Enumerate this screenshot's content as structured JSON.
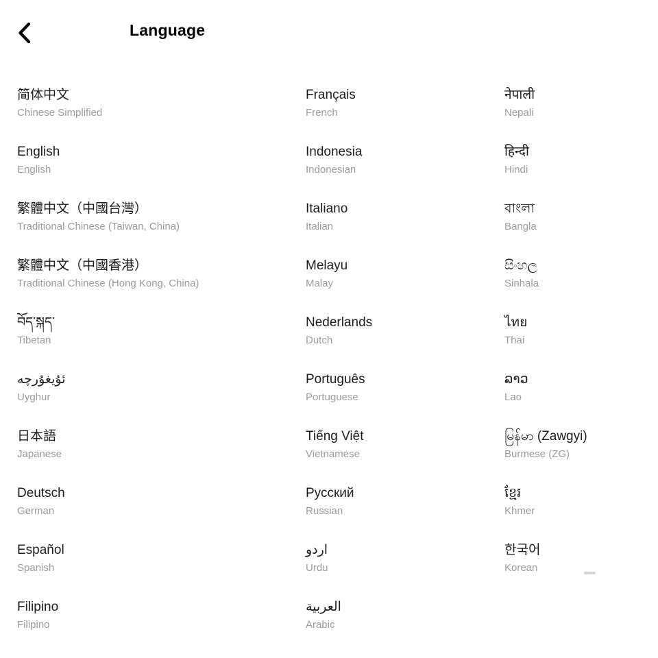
{
  "header": {
    "title": "Language",
    "back_icon": "chevron-left-icon"
  },
  "scroll_indicator": {
    "present": true,
    "color": "#d4d4d4"
  },
  "colors": {
    "background": "#ffffff",
    "primary_text": "#1c1c1c",
    "secondary_text": "#9b9b9b",
    "title_text": "#000000"
  },
  "columns": [
    {
      "items": [
        {
          "native": "简体中文",
          "english": "Chinese Simplified"
        },
        {
          "native": "English",
          "english": "English"
        },
        {
          "native": "繁體中文（中國台灣）",
          "english": "Traditional Chinese (Taiwan, China)"
        },
        {
          "native": "繁體中文（中國香港）",
          "english": "Traditional Chinese (Hong Kong, China)"
        },
        {
          "native": "བོད་སྐད་",
          "english": "Tibetan"
        },
        {
          "native": "ئۇيغۇرچە",
          "english": "Uyghur"
        },
        {
          "native": "日本語",
          "english": "Japanese"
        },
        {
          "native": "Deutsch",
          "english": "German"
        },
        {
          "native": "Español",
          "english": "Spanish"
        },
        {
          "native": "Filipino",
          "english": "Filipino"
        }
      ]
    },
    {
      "items": [
        {
          "native": "Français",
          "english": "French"
        },
        {
          "native": "Indonesia",
          "english": "Indonesian"
        },
        {
          "native": "Italiano",
          "english": "Italian"
        },
        {
          "native": "Melayu",
          "english": "Malay"
        },
        {
          "native": "Nederlands",
          "english": "Dutch"
        },
        {
          "native": "Português",
          "english": "Portuguese"
        },
        {
          "native": "Tiếng Việt",
          "english": "Vietnamese"
        },
        {
          "native": "Русский",
          "english": "Russian"
        },
        {
          "native": "اردو",
          "english": "Urdu"
        },
        {
          "native": "العربية",
          "english": "Arabic"
        }
      ]
    },
    {
      "items": [
        {
          "native": "नेपाली",
          "english": "Nepali"
        },
        {
          "native": "हिन्दी",
          "english": "Hindi"
        },
        {
          "native": "বাংলা",
          "english": "Bangla"
        },
        {
          "native": "සිංහල",
          "english": "Sinhala"
        },
        {
          "native": "ไทย",
          "english": "Thai"
        },
        {
          "native": "ລາວ",
          "english": "Lao"
        },
        {
          "native": "မြန်မာ (Zawgyi)",
          "english": "Burmese (ZG)"
        },
        {
          "native": "ខ្មែរ",
          "english": "Khmer"
        },
        {
          "native": "한국어",
          "english": "Korean"
        }
      ]
    }
  ]
}
